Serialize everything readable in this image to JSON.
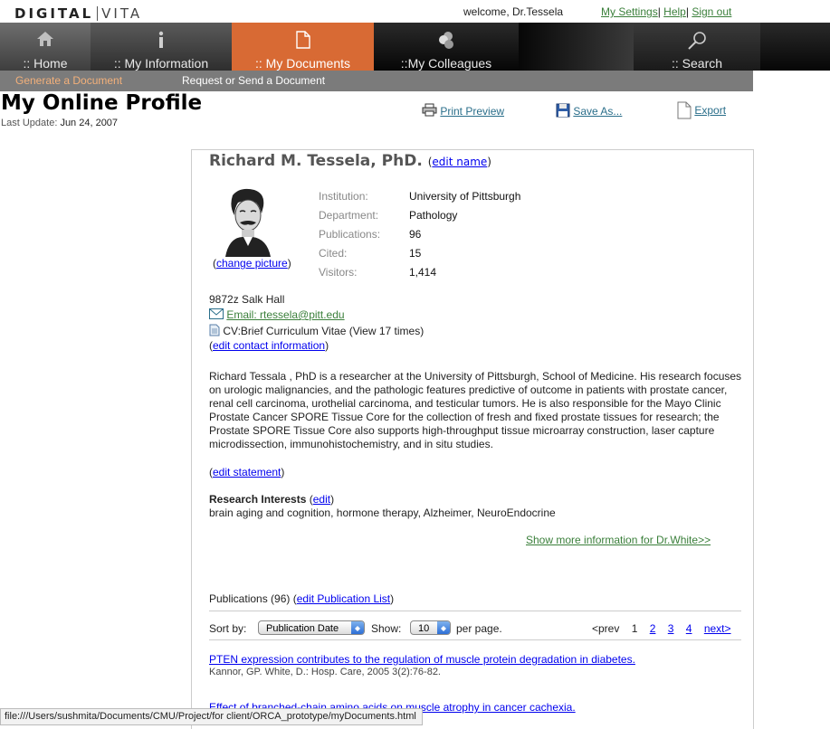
{
  "logo": {
    "part1": "DIGITAL",
    "part2": "VITA"
  },
  "header": {
    "welcome": "welcome, Dr.Tessela",
    "my_settings": "My Settings",
    "sep1": "|",
    "help": "Help",
    "sep2": "|",
    "sign_out": "Sign out"
  },
  "nav": {
    "home": ":: Home",
    "info": ":: My Information",
    "docs": ":: My Documents",
    "colleagues": "::My Colleagues",
    "search": ":: Search"
  },
  "subnav": {
    "generate": "Generate a Document",
    "request": "Request or Send a Document"
  },
  "page": {
    "title": "My Online Profile",
    "last_update_label": "Last Update:",
    "last_update": "Jun 24, 2007"
  },
  "actions": {
    "print": "Print Preview",
    "save": "Save As...",
    "export": "Export"
  },
  "profile": {
    "name": "Richard M. Tessela, PhD.",
    "edit_name_open": "(",
    "edit_name": "edit name",
    "edit_name_close": ")",
    "change_picture_open": "(",
    "change_picture": "change picture",
    "change_picture_close": ")",
    "stats": [
      {
        "label": "Institution:",
        "value": "University of Pittsburgh"
      },
      {
        "label": "Department:",
        "value": "Pathology"
      },
      {
        "label": "Publications:",
        "value": "96"
      },
      {
        "label": "Cited:",
        "value": "15"
      },
      {
        "label": "Visitors:",
        "value": "1,414"
      }
    ],
    "address": "9872z Salk Hall",
    "email": "Email: rtessela@pitt.edu",
    "cv": "CV:Brief Curriculum Vitae (View 17 times)",
    "edit_contact_open": "(",
    "edit_contact": "edit contact information",
    "edit_contact_close": ")",
    "bio": "Richard Tessala , PhD is a researcher at the University of Pittsburgh, School of Medicine. His research focuses on urologic malignancies, and the pathologic features predictive of outcome in patients with prostate cancer, renal cell carcinoma, urothelial carcinoma, and testicular tumors. He is also responsible for the Mayo Clinic Prostate Cancer SPORE Tissue Core for the collection of fresh and fixed prostate tissues for research; the Prostate SPORE Tissue Core also supports high-throughput tissue microarray construction, laser capture microdissection, immunohistochemistry, and in situ studies.",
    "edit_statement_open": "(",
    "edit_statement": "edit statement",
    "edit_statement_close": ")",
    "research_label": "Research Interests",
    "research_edit_open": " (",
    "research_edit": "edit",
    "research_edit_close": ")",
    "research": "brain aging and cognition, hormone therapy, Alzheimer, NeuroEndocrine",
    "show_more": "Show more information for Dr.White>>"
  },
  "publications": {
    "header": "Publications (96)",
    "edit_open": " (",
    "edit_link": "edit Publication List",
    "edit_close": ")",
    "sort_label": "Sort by:",
    "sort_value": "Publication Date",
    "show_label": "Show:",
    "show_value": "10",
    "per_page": "per page.",
    "pager": {
      "prev": "<prev",
      "current": "1",
      "pages": [
        "2",
        "3",
        "4"
      ],
      "next": "next>"
    },
    "items": [
      {
        "title": "PTEN expression contributes to the regulation of muscle protein degradation in diabetes.",
        "citation": "Kannor, GP. White, D.: Hosp. Care, 2005 3(2):76-82."
      },
      {
        "title": "Effect of branched-chain amino acids on muscle atrophy in cancer cachexia.",
        "citation": ""
      }
    ]
  },
  "status_bar": "file:///Users/sushmita/Documents/CMU/Project/for client/ORCA_prototype/myDocuments.html",
  "colors": {
    "accent_orange": "#d86a34",
    "subnav_gray": "#7b7b7b",
    "link_green": "#3a7f3a"
  }
}
